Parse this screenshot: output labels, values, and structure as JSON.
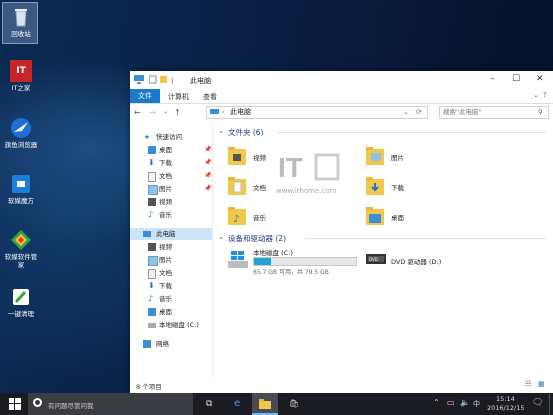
{
  "desktop": {
    "icons": [
      {
        "label": "回收站"
      },
      {
        "label": "IT之家"
      },
      {
        "label": "旗鱼浏览器"
      },
      {
        "label": "软媒魔方"
      },
      {
        "label": "软媒软件管家"
      },
      {
        "label": "一键清理"
      }
    ]
  },
  "window": {
    "title": "此电脑",
    "ribbon_tabs": [
      "文件",
      "计算机",
      "查看"
    ],
    "address": "此电脑",
    "search_placeholder": "搜索\"此电脑\"",
    "nav": {
      "quick_access": "快速访问",
      "quick_items": [
        "桌面",
        "下载",
        "文档",
        "图片",
        "视频",
        "音乐"
      ],
      "this_pc": "此电脑",
      "pc_items": [
        "视频",
        "图片",
        "文档",
        "下载",
        "音乐",
        "桌面",
        "本地磁盘 (C:)"
      ],
      "network": "网络"
    },
    "folders_header": "文件夹 (6)",
    "folders": [
      "视频",
      "图片",
      "文档",
      "下载",
      "音乐",
      "桌面"
    ],
    "drives_header": "设备和驱动器 (2)",
    "drive_c": {
      "name": "本地磁盘 (C:)",
      "info": "65.7 GB 可用，共 79.5 GB",
      "used_fraction": 0.17
    },
    "drive_d": {
      "name": "DVD 驱动器 (D:)"
    },
    "status": "8 个项目",
    "watermark": {
      "logo": "IT之家",
      "url": "www.ithome.com"
    }
  },
  "taskbar": {
    "search_placeholder": "有问题尽管问我",
    "time": "15:14",
    "date": "2016/12/15"
  },
  "colors": {
    "accent": "#1979ca",
    "folder": "#f2c84b",
    "drive_bar": "#26a0da"
  }
}
